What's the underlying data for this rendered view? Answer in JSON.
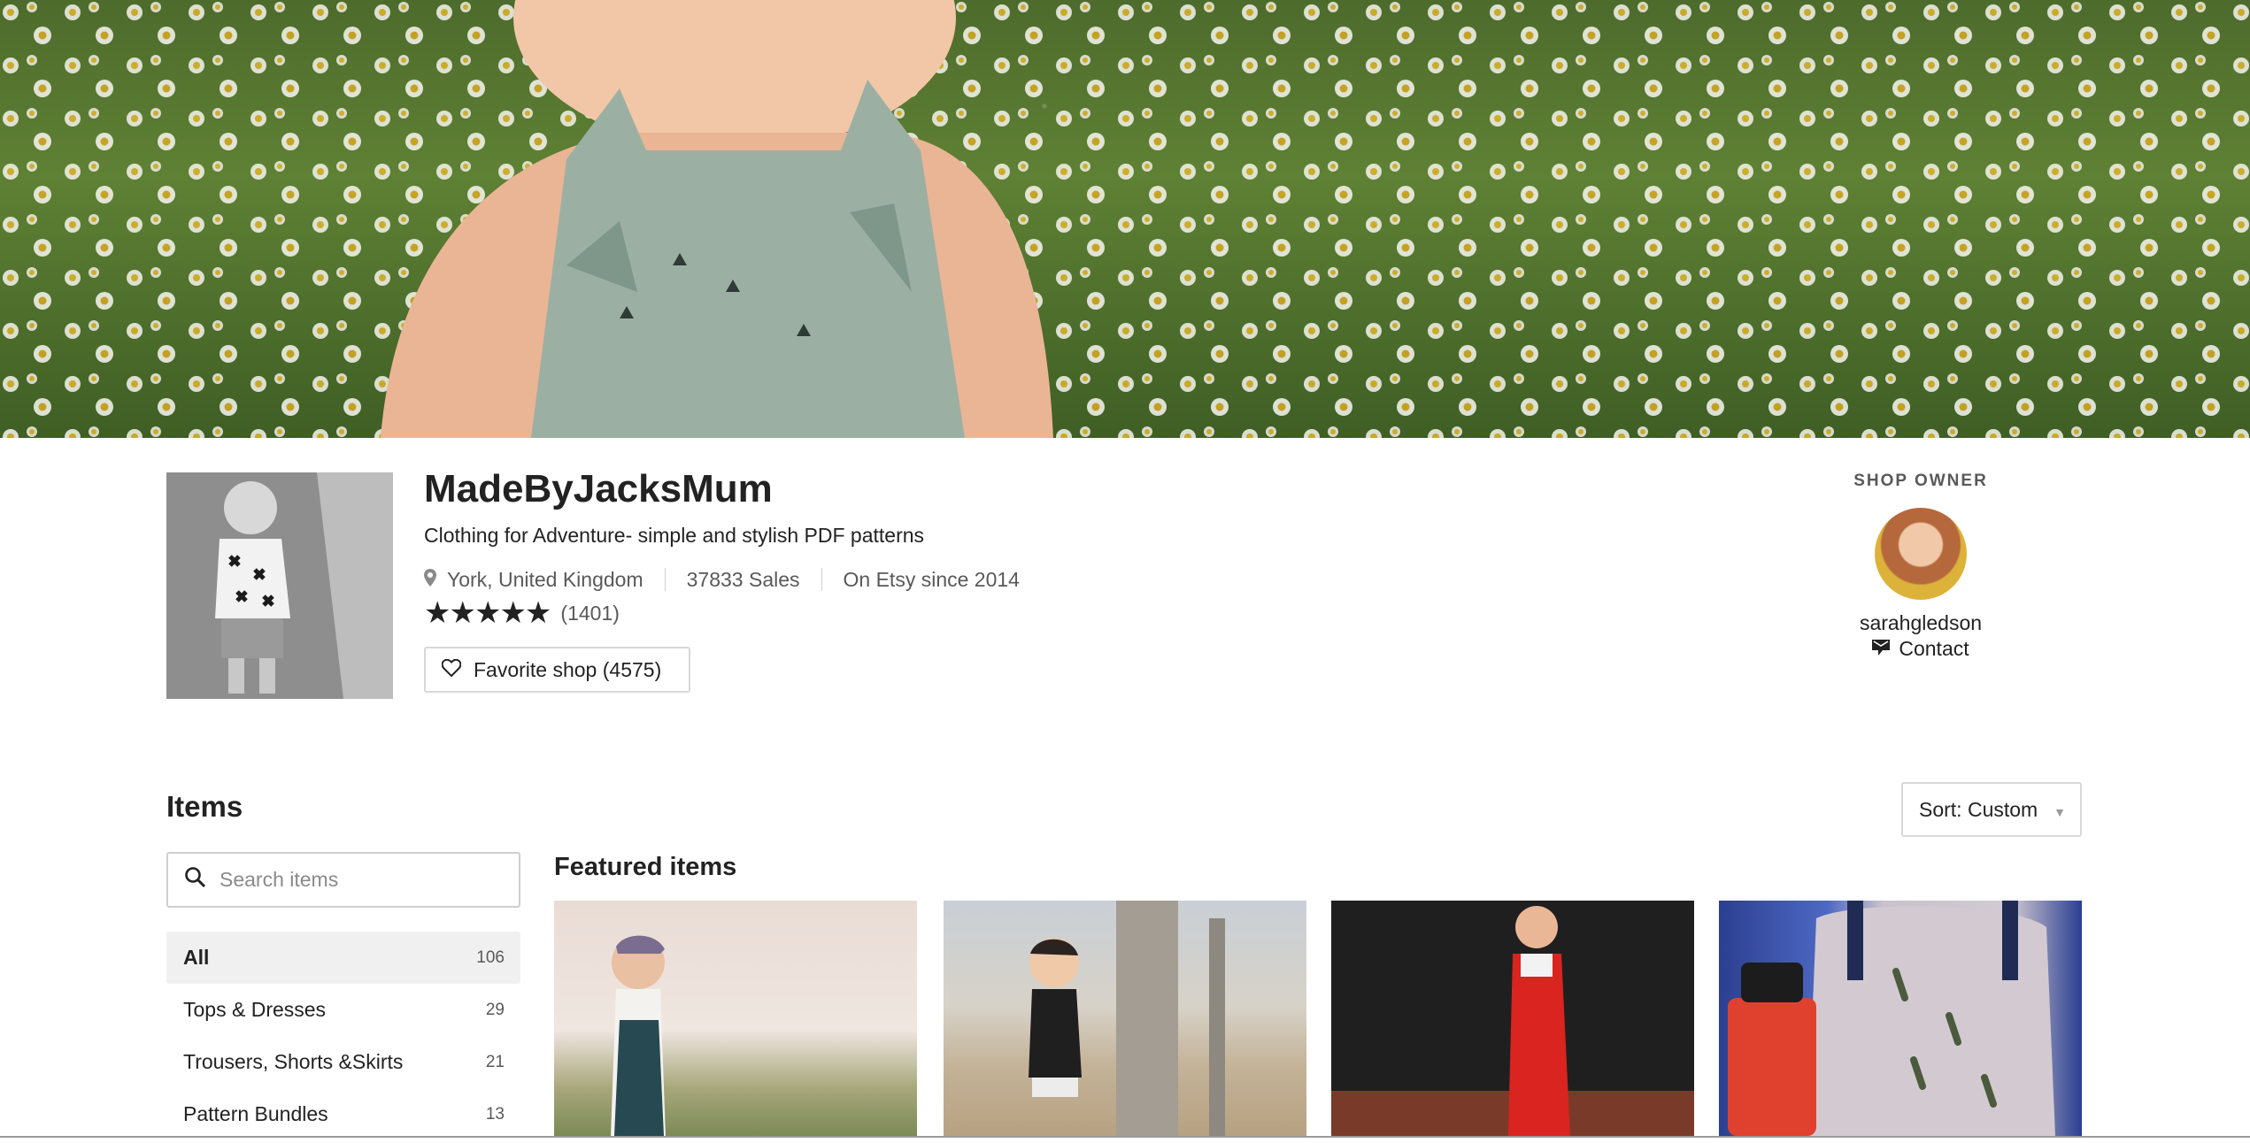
{
  "banner": {
    "icon": "daisy-field-photo"
  },
  "shop": {
    "name": "MadeByJacksMum",
    "tagline": "Clothing for Adventure- simple and stylish PDF patterns",
    "location": "York, United Kingdom",
    "sales": "37833 Sales",
    "since": "On Etsy since 2014",
    "rating_stars": 5,
    "rating_count": "(1401)",
    "favorite_label": "Favorite shop (4575)"
  },
  "owner": {
    "label": "SHOP OWNER",
    "name": "sarahgledson",
    "contact_label": "Contact"
  },
  "items": {
    "title": "Items",
    "sort_label": "Sort: Custom",
    "search_placeholder": "Search items",
    "featured_title": "Featured items",
    "categories": [
      {
        "label": "All",
        "count": "106",
        "active": true
      },
      {
        "label": "Tops & Dresses",
        "count": "29",
        "active": false
      },
      {
        "label": "Trousers, Shorts &Skirts",
        "count": "21",
        "active": false
      },
      {
        "label": "Pattern Bundles",
        "count": "13",
        "active": false
      }
    ]
  },
  "colors": {
    "text": "#222222",
    "muted": "#595959",
    "active_bg": "#f0f0f0",
    "border": "#d8d8d8"
  }
}
